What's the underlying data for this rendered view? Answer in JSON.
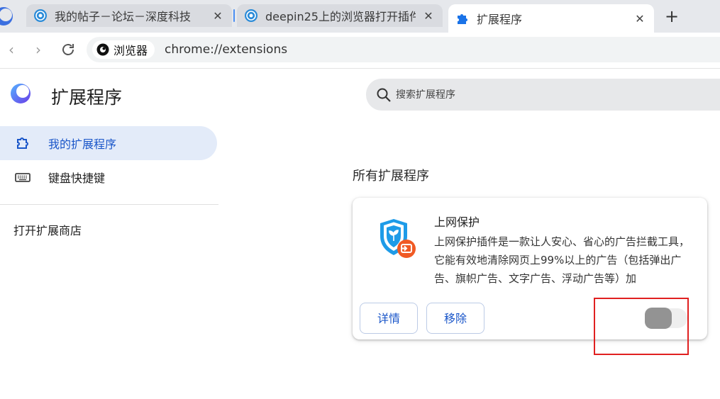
{
  "tabs": [
    {
      "title": "我的帖子－论坛－深度科技",
      "close": "✕"
    },
    {
      "title": "deepin25上的浏览器打开插件",
      "close": "✕"
    },
    {
      "title": "扩展程序",
      "close": "✕"
    }
  ],
  "new_tab": "+",
  "toolbar": {
    "back": "‹",
    "forward": "›",
    "reload": "↻",
    "brand_label": "浏览器",
    "url": "chrome://extensions"
  },
  "page": {
    "title": "扩展程序",
    "search_placeholder": "搜索扩展程序"
  },
  "sidebar": {
    "items": [
      {
        "label": "我的扩展程序",
        "icon": "puzzle-icon",
        "active": true
      },
      {
        "label": "键盘快捷键",
        "icon": "keyboard-icon",
        "active": false
      }
    ],
    "store_link": "打开扩展商店"
  },
  "main": {
    "section_title": "所有扩展程序",
    "extension": {
      "name": "上网保护",
      "description": "上网保护插件是一款让人安心、省心的广告拦截工具，它能有效地清除网页上99%以上的广告（包括弹出广告、旗帜广告、文字广告、浮动广告等）加",
      "details_button": "详情",
      "remove_button": "移除",
      "enabled": false
    }
  },
  "colors": {
    "accent": "#1a56c9",
    "highlight": "#e02020"
  }
}
